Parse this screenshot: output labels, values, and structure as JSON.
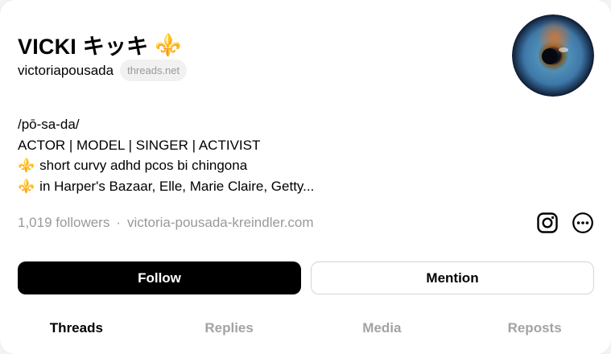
{
  "profile": {
    "name": "VICKI キッキ",
    "name_emoji": "⚜️",
    "handle": "victoriapousada",
    "domain_badge": "threads.net"
  },
  "bio": {
    "line1": "/pō-sa-da/",
    "line2": "ACTOR | MODEL | SINGER | ACTIVIST",
    "line3_emoji": "⚜️",
    "line3": "short curvy adhd pcos bi chingona",
    "line4_emoji": "⚜️",
    "line4": "in Harper's Bazaar, Elle, Marie Claire, Getty..."
  },
  "meta": {
    "followers": "1,019 followers",
    "separator": "·",
    "link": "victoria-pousada-kreindler.com"
  },
  "actions": {
    "follow": "Follow",
    "mention": "Mention"
  },
  "tabs": [
    {
      "label": "Threads"
    },
    {
      "label": "Replies"
    },
    {
      "label": "Media"
    },
    {
      "label": "Reposts"
    }
  ],
  "icons": {
    "instagram": "instagram-icon",
    "more": "more-options-icon"
  },
  "colors": {
    "accent": "#000000",
    "muted": "#999999",
    "tab_inactive": "#a3a3a3",
    "fleur": "#b8860b"
  }
}
